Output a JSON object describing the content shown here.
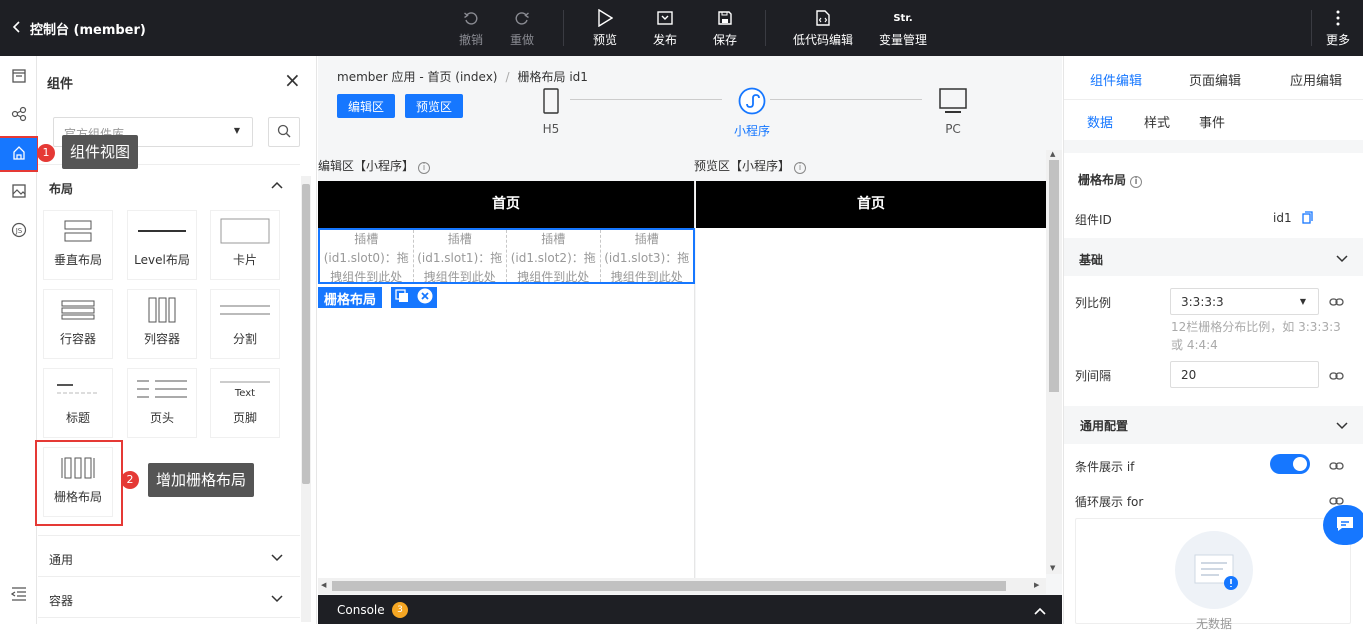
{
  "topbar": {
    "title": "控制台 (member)",
    "undo": "撤销",
    "redo": "重做",
    "preview": "预览",
    "publish": "发布",
    "save": "保存",
    "lowcode": "低代码编辑",
    "var_icon": "Str.",
    "var": "变量管理",
    "more": "更多"
  },
  "panel": {
    "title": "组件",
    "library": "官方组件库",
    "groups": {
      "layout": "布局",
      "common": "通用",
      "container": "容器"
    },
    "components": [
      "垂直布局",
      "Level布局",
      "卡片",
      "行容器",
      "列容器",
      "分割",
      "标题",
      "页头",
      "页脚",
      "栅格布局"
    ],
    "footer_preview_text": "Text"
  },
  "callouts": {
    "c1_num": "1",
    "c1_text": "组件视图",
    "c2_num": "2",
    "c2_text": "增加栅格布局"
  },
  "center": {
    "crumb_app": "member 应用 - 首页 (index)",
    "crumb_sep": "/",
    "crumb_item": "栅格布局 id1",
    "edit_btn": "编辑区",
    "preview_btn": "预览区",
    "devices": [
      "H5",
      "小程序",
      "PC"
    ],
    "edit_zone": "编辑区【小程序】",
    "preview_zone": "预览区【小程序】",
    "nav_title": "首页",
    "slots": [
      [
        "插槽",
        "(id1.slot0)：拖",
        "拽组件到此处"
      ],
      [
        "插槽",
        "(id1.slot1)：拖",
        "拽组件到此处"
      ],
      [
        "插槽",
        "(id1.slot2)：拖",
        "拽组件到此处"
      ],
      [
        "插槽",
        "(id1.slot3)：拖",
        "拽组件到此处"
      ]
    ],
    "grid_tag": "栅格布局",
    "console": "Console",
    "console_count": "3"
  },
  "right": {
    "tabs": [
      "组件编辑",
      "页面编辑",
      "应用编辑"
    ],
    "subtabs": [
      "数据",
      "样式",
      "事件"
    ],
    "comp_name": "栅格布局",
    "id_label": "组件ID",
    "id_value": "id1",
    "basic": "基础",
    "ratio_label": "列比例",
    "ratio_value": "3:3:3:3",
    "ratio_hint": "12栏栅格分布比例，如 3:3:3:3 或 4:4:4",
    "gap_label": "列间隔",
    "gap_value": "20",
    "general": "通用配置",
    "if_label": "条件展示 if",
    "if_on": true,
    "for_label": "循环展示 for",
    "empty_text": "无数据"
  },
  "colors": {
    "accent": "#1677ff",
    "highlight": "#e53935",
    "topbar": "#1e1f24"
  }
}
